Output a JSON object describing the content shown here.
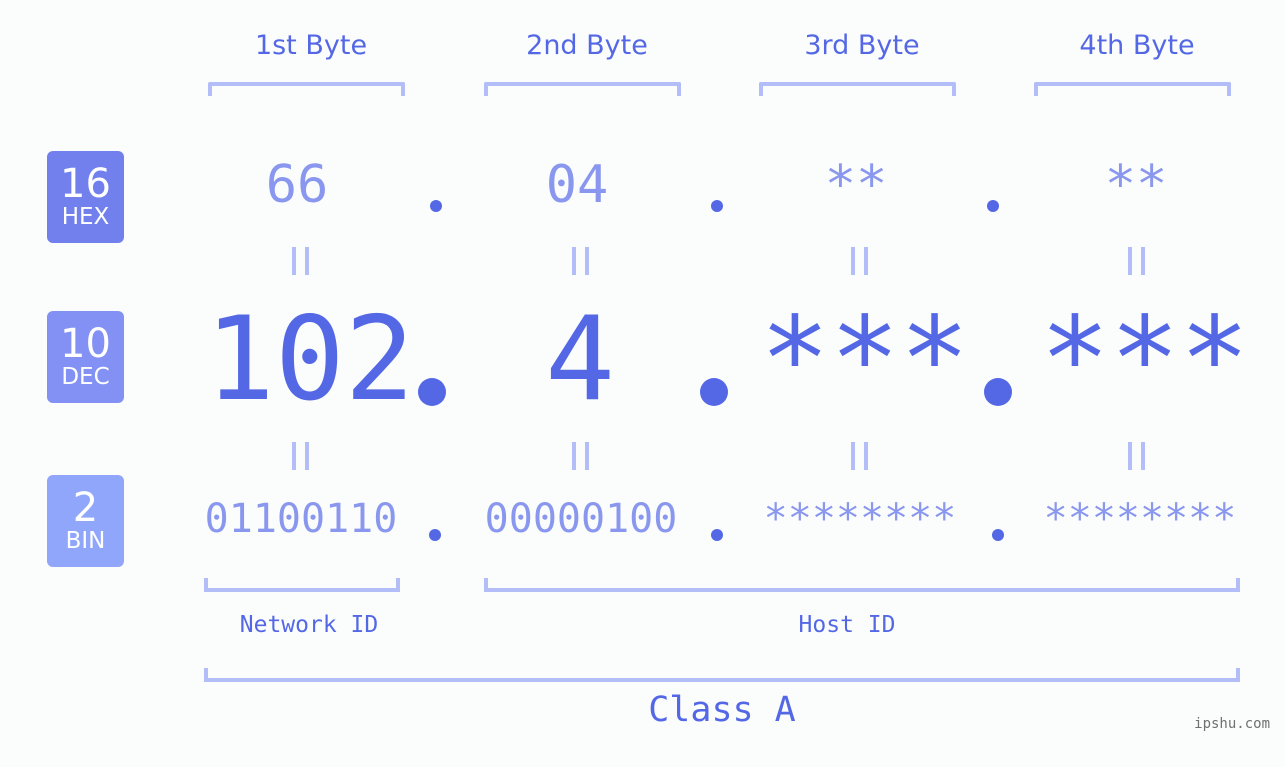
{
  "bytes": {
    "labels": [
      "1st Byte",
      "2nd Byte",
      "3rd Byte",
      "4th Byte"
    ]
  },
  "bases": {
    "hex": {
      "number": "16",
      "label": "HEX",
      "color": "#7280ee"
    },
    "dec": {
      "number": "10",
      "label": "DEC",
      "color": "#8291f3"
    },
    "bin": {
      "number": "2",
      "label": "BIN",
      "color": "#90a6fb"
    }
  },
  "hex_values": [
    "66",
    "04",
    "**",
    "**"
  ],
  "dec_values": [
    "102",
    "4",
    "***",
    "***"
  ],
  "bin_values": [
    "01100110",
    "00000100",
    "********",
    "********"
  ],
  "ids": {
    "network": "Network ID",
    "host": "Host ID"
  },
  "class_label": "Class A",
  "watermark": "ipshu.com",
  "colors": {
    "accent": "#5468e6",
    "light_value": "#8a97ee",
    "bracket": "#b3bdf8",
    "background": "#fbfdfc"
  }
}
